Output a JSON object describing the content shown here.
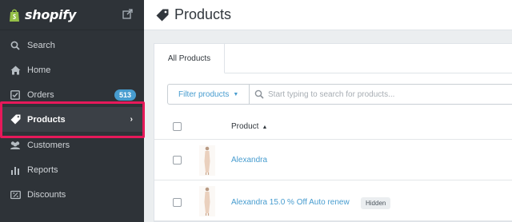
{
  "brand": {
    "name": "shopify"
  },
  "sidebar": {
    "items": [
      {
        "label": "Search",
        "icon": "search-icon"
      },
      {
        "label": "Home",
        "icon": "home-icon"
      },
      {
        "label": "Orders",
        "icon": "orders-icon",
        "badge": "513"
      },
      {
        "label": "Products",
        "icon": "tag-icon",
        "active": true
      },
      {
        "label": "Customers",
        "icon": "customers-icon"
      },
      {
        "label": "Reports",
        "icon": "reports-icon"
      },
      {
        "label": "Discounts",
        "icon": "discounts-icon"
      }
    ]
  },
  "header": {
    "title": "Products"
  },
  "tabs": [
    {
      "label": "All Products"
    }
  ],
  "filter": {
    "label": "Filter products"
  },
  "search": {
    "placeholder": "Start typing to search for products..."
  },
  "table": {
    "column_product": "Product",
    "rows": [
      {
        "name": "Alexandra",
        "status": ""
      },
      {
        "name": "Alexandra 15.0 % Off Auto renew",
        "status": "Hidden"
      }
    ]
  },
  "colors": {
    "sidebar": "#2e3338",
    "accent": "#479ccf",
    "highlight": "#e6195a",
    "badge": "#479ccf"
  }
}
